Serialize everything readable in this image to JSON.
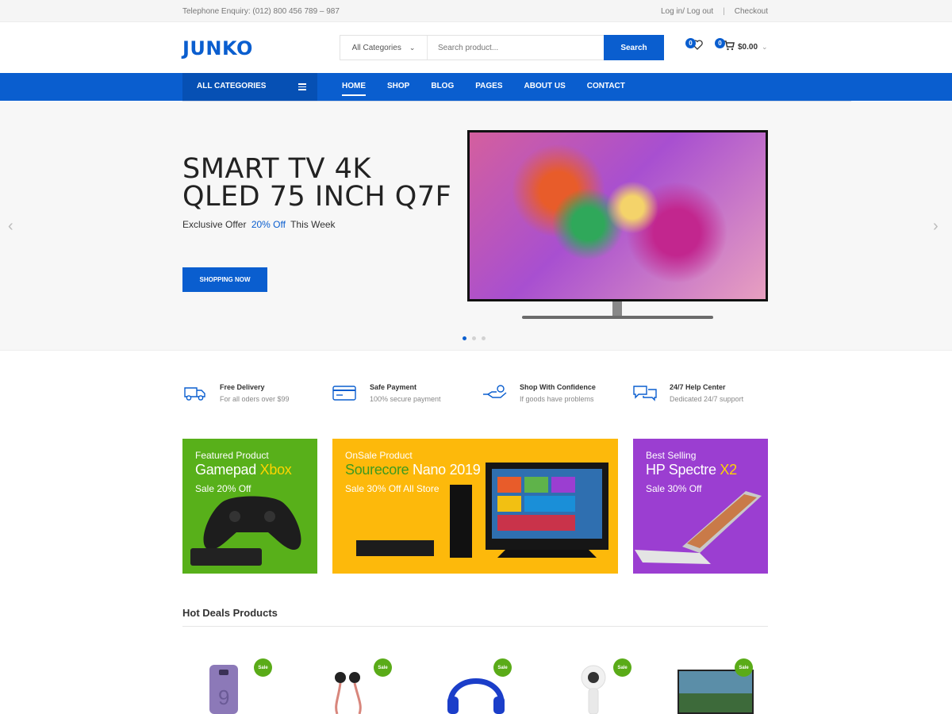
{
  "topbar": {
    "phone": "Telephone Enquiry: (012) 800 456 789 – 987",
    "login": "Log in/ Log out",
    "separator": "|",
    "checkout": "Checkout"
  },
  "header": {
    "logo": "JUNKO",
    "search_category": "All Categories",
    "search_placeholder": "Search product...",
    "search_button": "Search",
    "wishlist_count": "0",
    "cart_count": "0",
    "cart_total": "$0.00",
    "icons": [
      "heart-icon",
      "cart-icon",
      "chevron-down-icon"
    ]
  },
  "nav": {
    "all_categories": "ALL CATEGORIES",
    "items": [
      "HOME",
      "SHOP",
      "BLOG",
      "PAGES",
      "ABOUT US",
      "CONTACT"
    ],
    "active": "HOME"
  },
  "hero": {
    "title_line1": "SMART TV 4K",
    "title_line2": "QLED 75 INCH Q7F",
    "offer_pre": "Exclusive Offer",
    "offer_highlight": "20% Off",
    "offer_post": "This Week",
    "button": "SHOPPING NOW",
    "prev_arrow": "‹",
    "next_arrow": "›",
    "slide_count": 3,
    "active_slide": 1
  },
  "features": [
    {
      "title": "Free Delivery",
      "subtitle": "For all oders over $99",
      "icon": "truck-icon"
    },
    {
      "title": "Safe Payment",
      "subtitle": "100% secure payment",
      "icon": "credit-card-icon"
    },
    {
      "title": "Shop With Confidence",
      "subtitle": "If goods have problems",
      "icon": "hand-shield-icon"
    },
    {
      "title": "24/7 Help Center",
      "subtitle": "Dedicated 24/7 support",
      "icon": "chat-icon"
    }
  ],
  "banners": [
    {
      "label": "Featured Product",
      "name_pre": "Gamepad",
      "name_hl": "Xbox",
      "name_post": "",
      "offer": "Sale 20% Off",
      "bg": "#58b01a",
      "hl_color": "#ffd400"
    },
    {
      "label": "OnSale Product",
      "name_pre": "",
      "name_hl": "Sourecore",
      "name_post": " Nano 2019",
      "offer": "Sale 30% Off All Store",
      "bg": "#fdb90b",
      "hl_color": "#3d9a1f"
    },
    {
      "label": "Best Selling",
      "name_pre": "HP Spectre",
      "name_hl": "X2",
      "name_post": "",
      "offer": "Sale 30% Off",
      "bg": "#9b3ed1",
      "hl_color": "#ffd400"
    }
  ],
  "hot_deals": {
    "title": "Hot Deals Products",
    "sale_label": "Sale",
    "products": [
      "phone",
      "earphones",
      "headphones",
      "camera",
      "tv"
    ]
  },
  "colors": {
    "primary": "#0a5ecf",
    "sale_green": "#5aab18"
  }
}
